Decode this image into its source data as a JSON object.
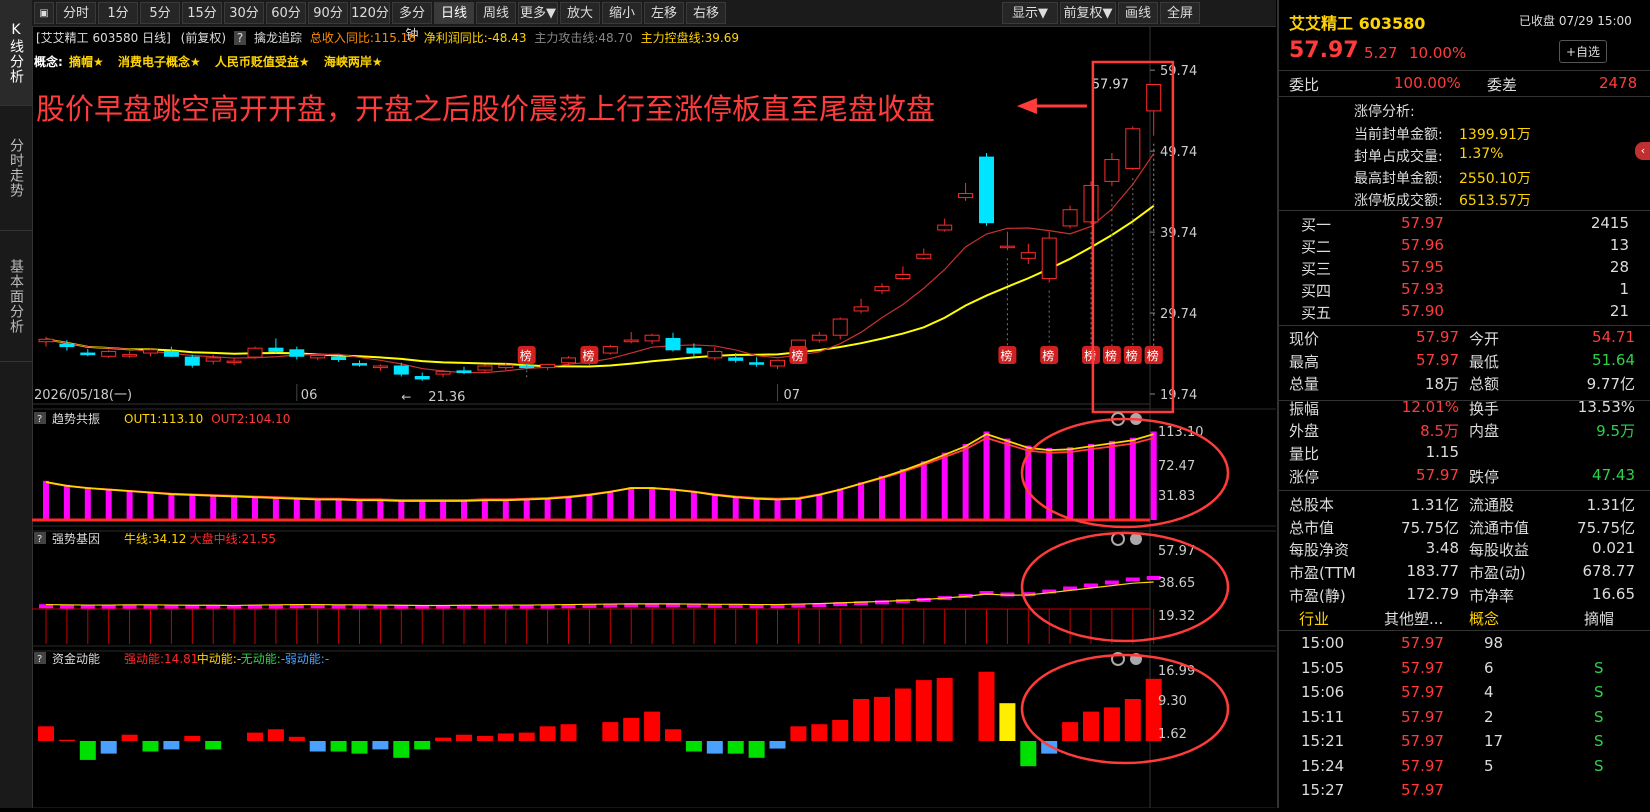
{
  "vertical_tabs": [
    "K线分析",
    "分时走势",
    "基本面分析"
  ],
  "toolbar": {
    "left_buttons": [
      "分时",
      "1分",
      "5分",
      "15分",
      "30分",
      "60分",
      "90分",
      "120分",
      "多分钟",
      "日线",
      "周线",
      "更多▼",
      "放大",
      "缩小",
      "左移",
      "右移"
    ],
    "active": "日线",
    "right_buttons": [
      "显示▼",
      "前复权▼",
      "画线",
      "全屏"
    ]
  },
  "info_line": {
    "title": "[艾艾精工 603580 日线]",
    "adj": "(前复权)",
    "q": "?",
    "indicator": "擒龙追踪",
    "rev": "总收入同比:115.18",
    "profit": "净利润同比:-48.43",
    "attack": "主力攻击线:48.70",
    "control": "主力控盘线:39.69"
  },
  "concepts": {
    "label": "概念:",
    "items": [
      "摘帽★",
      "消费电子概念★",
      "人民币贬值受益★",
      "海峡两岸★"
    ]
  },
  "annotation": "股价早盘跳空高开开盘，开盘之后股价震荡上行至涨停板直至尾盘收盘",
  "price_axis": [
    "59.74",
    "49.74",
    "39.74",
    "29.74",
    "19.74"
  ],
  "price_labels": {
    "high": "57.97",
    "low": "21.36"
  },
  "date_axis": {
    "start": "2026/05/18(一)",
    "m6": "06",
    "m7": "07"
  },
  "rank_badge": "榜",
  "panels": {
    "trend": {
      "name": "趋势共振",
      "l1": "OUT1:113.10",
      "l2": "OUT2:104.10",
      "axis": [
        "113.10",
        "72.47",
        "31.83"
      ]
    },
    "gene": {
      "name": "强势基因",
      "l1": "牛线:34.12",
      "l2": "大盘中线:21.55",
      "axis": [
        "57.97",
        "38.65",
        "19.32"
      ]
    },
    "money": {
      "name": "资金动能",
      "l1": "强动能:14.81",
      "l2": "中动能:-",
      "l3": "无动能:-",
      "l4": "弱动能:-",
      "axis": [
        "16.99",
        "9.30",
        "1.62"
      ]
    }
  },
  "chart_data": {
    "type": "candlestick",
    "candles_ohlc": [
      [
        26.2,
        26.8,
        25.6,
        26.5
      ],
      [
        25.9,
        26.4,
        25.1,
        25.6
      ],
      [
        24.8,
        25.3,
        24.4,
        24.6
      ],
      [
        24.4,
        25.2,
        24.2,
        25.0
      ],
      [
        24.5,
        25.0,
        24.2,
        24.6
      ],
      [
        24.8,
        25.4,
        24.4,
        25.2
      ],
      [
        25.0,
        25.6,
        24.3,
        24.4
      ],
      [
        24.3,
        24.6,
        23.0,
        23.3
      ],
      [
        23.8,
        24.6,
        23.4,
        24.2
      ],
      [
        23.7,
        24.2,
        23.3,
        23.8
      ],
      [
        24.3,
        25.6,
        24.1,
        25.4
      ],
      [
        25.4,
        26.6,
        24.8,
        25.0
      ],
      [
        25.2,
        25.6,
        24.0,
        24.4
      ],
      [
        24.2,
        24.7,
        23.9,
        24.5
      ],
      [
        24.3,
        24.6,
        23.7,
        24.0
      ],
      [
        23.5,
        23.9,
        23.1,
        23.4
      ],
      [
        23.0,
        23.4,
        22.6,
        23.2
      ],
      [
        23.2,
        23.6,
        21.9,
        22.2
      ],
      [
        21.9,
        22.4,
        21.36,
        21.6
      ],
      [
        22.2,
        22.7,
        21.8,
        22.5
      ],
      [
        22.6,
        23.1,
        22.2,
        22.4
      ],
      [
        22.7,
        23.4,
        22.4,
        23.2
      ],
      [
        23.0,
        23.6,
        22.7,
        23.3
      ],
      [
        23.2,
        23.8,
        22.8,
        23.0
      ],
      [
        23.0,
        23.5,
        22.7,
        23.4
      ],
      [
        23.6,
        24.4,
        23.3,
        24.2
      ],
      [
        25.0,
        25.7,
        24.2,
        24.4
      ],
      [
        24.8,
        25.8,
        24.6,
        25.6
      ],
      [
        26.2,
        27.4,
        26.0,
        26.4
      ],
      [
        26.3,
        27.2,
        25.9,
        27.0
      ],
      [
        26.6,
        27.3,
        25.0,
        25.2
      ],
      [
        25.4,
        26.0,
        24.4,
        24.8
      ],
      [
        24.2,
        25.5,
        23.9,
        25.0
      ],
      [
        24.2,
        24.8,
        23.6,
        23.9
      ],
      [
        23.6,
        24.3,
        23.1,
        23.5
      ],
      [
        23.2,
        24.0,
        22.8,
        23.9
      ],
      [
        24.4,
        26.4,
        24.4,
        26.4
      ],
      [
        26.4,
        27.4,
        26.1,
        27.0
      ],
      [
        27.0,
        29.2,
        26.5,
        29.0
      ],
      [
        30.0,
        31.5,
        29.7,
        30.5
      ],
      [
        32.5,
        33.4,
        32.1,
        33.0
      ],
      [
        34.0,
        35.5,
        33.8,
        34.5
      ],
      [
        36.5,
        37.7,
        36.3,
        37.0
      ],
      [
        40.0,
        41.4,
        39.8,
        40.6
      ],
      [
        44.0,
        45.8,
        43.6,
        44.5
      ],
      [
        49.0,
        49.5,
        40.5,
        40.9
      ],
      [
        38.0,
        39.8,
        37.5,
        38.0
      ],
      [
        36.5,
        38.3,
        35.8,
        37.2
      ],
      [
        34.0,
        39.8,
        33.5,
        39.0
      ],
      [
        40.5,
        43.0,
        40.2,
        42.5
      ],
      [
        41.0,
        46.0,
        40.7,
        45.5
      ],
      [
        46.0,
        49.5,
        45.4,
        48.7
      ],
      [
        47.6,
        52.8,
        47.4,
        52.5
      ],
      [
        54.71,
        57.97,
        51.64,
        57.97
      ]
    ],
    "ma5_last": 48.7,
    "ma_slow_last": 39.69,
    "y_range": [
      19.0,
      60.5
    ],
    "trend_bars": [
      50,
      45,
      42,
      40,
      38,
      36,
      34,
      33,
      32,
      31,
      30,
      29,
      28,
      27,
      27,
      26,
      26,
      25,
      25,
      25,
      25,
      26,
      26,
      27,
      28,
      30,
      33,
      37,
      42,
      42,
      40,
      37,
      33,
      30,
      28,
      27,
      28,
      33,
      40,
      48,
      56,
      65,
      75,
      86,
      97,
      113,
      104,
      95,
      92,
      93,
      97,
      101,
      105,
      113
    ],
    "gene_bars": [
      0.6,
      0.5,
      0.4,
      0.4,
      0.5,
      0.5,
      0.4,
      0.3,
      0.3,
      0.2,
      0.4,
      0.5,
      0.6,
      0.6,
      0.5,
      0.5,
      0.4,
      0.3,
      0.2,
      0.2,
      0.3,
      0.3,
      0.4,
      0.4,
      0.5,
      0.6,
      0.7,
      0.8,
      0.9,
      0.9,
      0.9,
      0.8,
      0.7,
      0.7,
      0.6,
      0.6,
      0.8,
      1.0,
      1.3,
      1.6,
      1.9,
      2.3,
      2.7,
      3.3,
      4.0,
      5.0,
      4.5,
      4.6,
      5.5,
      6.5,
      7.5,
      8.5,
      9.5,
      10.0
    ],
    "money_bars": [
      3.5,
      0.3,
      -4.5,
      -3.0,
      1.5,
      -2.5,
      -2.0,
      1.2,
      -2.0,
      2.0,
      2.8,
      1.0,
      -2.5,
      -2.5,
      -3.0,
      -2.0,
      -4.0,
      -2.0,
      0.8,
      1.5,
      1.2,
      1.8,
      2.0,
      3.5,
      4.0,
      4.5,
      5.5,
      7.0,
      2.8,
      -2.5,
      -3.0,
      -3.0,
      -4.0,
      -1.8,
      3.5,
      4.0,
      5.0,
      10.0,
      10.5,
      12.5,
      14.5,
      15.0,
      16.5,
      9.0,
      -6.0,
      -3.0,
      4.5,
      7.0,
      8.0,
      10.0,
      14.81
    ],
    "top_rank_points": [
      23,
      26,
      36,
      46,
      48,
      50,
      51,
      52,
      54,
      55
    ]
  },
  "right_panel": {
    "name": "艾艾精工 603580",
    "status": "已收盘 07/29 15:00",
    "price": "57.97",
    "change": "5.27",
    "pct": "10.00%",
    "fav": "+自选",
    "wb_label": "委比",
    "wb": "100.00%",
    "wc_label": "委差",
    "wc": "2478",
    "limit_title": "涨停分析:",
    "limit_rows": [
      [
        "当前封单金额:",
        "1399.91万"
      ],
      [
        "封单占成交量:",
        "1.37%"
      ],
      [
        "最高封单金额:",
        "2550.10万"
      ],
      [
        "涨停板成交额:",
        "6513.57万"
      ]
    ],
    "bids": [
      [
        "买一",
        "57.97",
        "2415"
      ],
      [
        "买二",
        "57.96",
        "13"
      ],
      [
        "买三",
        "57.95",
        "28"
      ],
      [
        "买四",
        "57.93",
        "1"
      ],
      [
        "买五",
        "57.90",
        "21"
      ]
    ],
    "stats": [
      [
        "现价",
        "57.97",
        "今开",
        "54.71"
      ],
      [
        "最高",
        "57.97",
        "最低",
        "51.64"
      ],
      [
        "总量",
        "18万",
        "总额",
        "9.77亿"
      ],
      [
        "振幅",
        "12.01%",
        "换手",
        "13.53%"
      ],
      [
        "外盘",
        "8.5万",
        "内盘",
        "9.5万"
      ],
      [
        "量比",
        "1.15",
        "",
        ""
      ],
      [
        "涨停",
        "57.97",
        "跌停",
        "47.43"
      ],
      [
        "总股本",
        "1.31亿",
        "流通股",
        "1.31亿"
      ],
      [
        "总市值",
        "75.75亿",
        "流通市值",
        "75.75亿"
      ],
      [
        "每股净资",
        "3.48",
        "每股收益",
        "0.021"
      ],
      [
        "市盈(TTM",
        "183.77",
        "市盈(动)",
        "678.77"
      ],
      [
        "市盈(静)",
        "172.79",
        "市净率",
        "16.65"
      ]
    ],
    "industry": [
      "行业",
      "其他塑...",
      "概念",
      "摘帽"
    ],
    "ticks": [
      [
        "15:00",
        "57.97",
        "98",
        ""
      ],
      [
        "15:05",
        "57.97",
        "6",
        "S"
      ],
      [
        "15:06",
        "57.97",
        "4",
        "S"
      ],
      [
        "15:11",
        "57.97",
        "2",
        "S"
      ],
      [
        "15:21",
        "57.97",
        "17",
        "S"
      ],
      [
        "15:24",
        "57.97",
        "5",
        "S"
      ],
      [
        "15:27",
        "57.97",
        "",
        ""
      ]
    ]
  },
  "colors": {
    "up": "#ff2a2a",
    "down": "#00e5ff",
    "ma_fast": "#c83232",
    "ma_slow": "#ffff00",
    "bar_magenta": "#ff00ff",
    "annotation": "#ff3b3b"
  }
}
